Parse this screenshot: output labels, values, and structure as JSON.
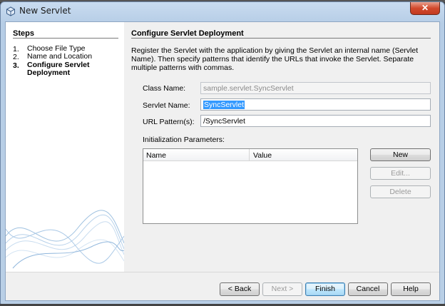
{
  "window": {
    "title": "New Servlet",
    "close_glyph": "✕",
    "icon": "netbeans-icon"
  },
  "steps": {
    "title": "Steps",
    "items": [
      {
        "num": "1.",
        "label": "Choose File Type"
      },
      {
        "num": "2.",
        "label": "Name and Location"
      },
      {
        "num": "3.",
        "label": "Configure Servlet Deployment"
      }
    ],
    "current_index": 2
  },
  "main": {
    "title": "Configure Servlet Deployment",
    "description": "Register the Servlet with the application by giving the Servlet an internal name (Servlet Name). Then specify patterns that identify the URLs that invoke the Servlet. Separate multiple patterns with commas.",
    "class_name": {
      "label": "Class Name:",
      "value": "sample.servlet.SyncServlet"
    },
    "servlet_name": {
      "label": "Servlet Name:",
      "value": "SyncServlet"
    },
    "url_pattern": {
      "label": "URL Pattern(s):",
      "value": "/SyncServlet"
    },
    "params": {
      "label": "Initialization Parameters:",
      "columns": [
        "Name",
        "Value"
      ],
      "rows": []
    },
    "side_buttons": {
      "new": "New",
      "edit": "Edit...",
      "delete": "Delete"
    }
  },
  "footer": {
    "back": "< Back",
    "next": "Next >",
    "finish": "Finish",
    "cancel": "Cancel",
    "help": "Help"
  },
  "colors": {
    "selection": "#3399ff",
    "title_bar": "#b9cfe6",
    "close_button": "#d2492c"
  }
}
